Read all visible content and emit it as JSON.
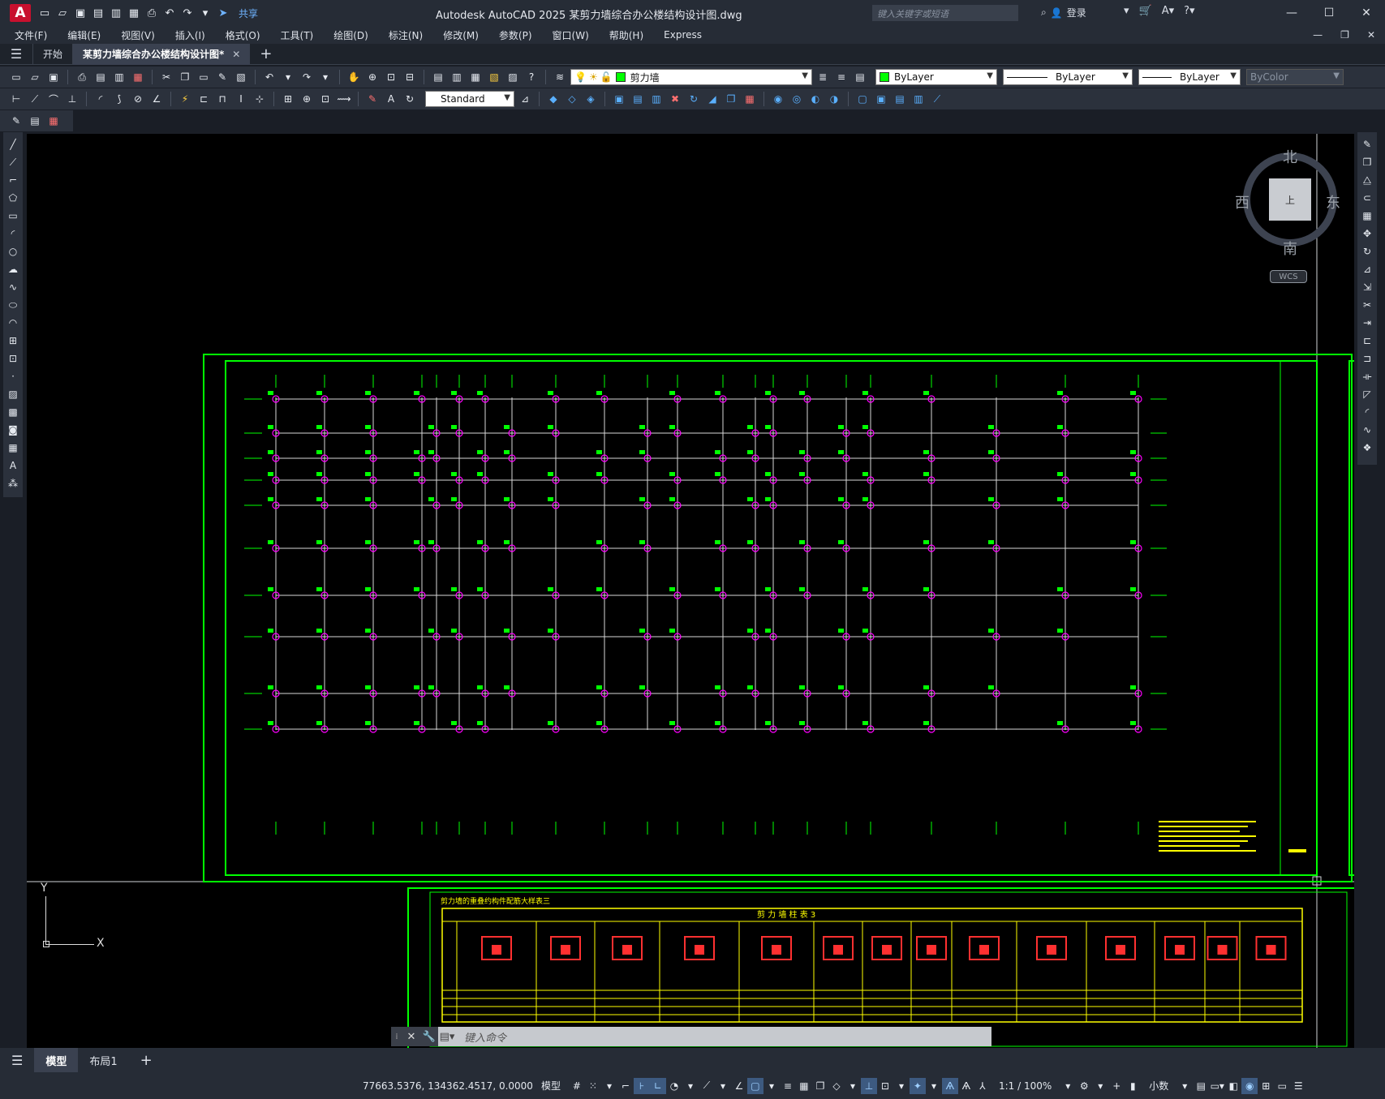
{
  "app": {
    "logo_letter": "A",
    "title": "Autodesk AutoCAD 2025    某剪力墙综合办公楼结构设计图.dwg",
    "share_label": "共享",
    "search_placeholder": "键入关键字或短语",
    "login_label": "登录"
  },
  "menu": [
    "文件(F)",
    "编辑(E)",
    "视图(V)",
    "插入(I)",
    "格式(O)",
    "工具(T)",
    "绘图(D)",
    "标注(N)",
    "修改(M)",
    "参数(P)",
    "窗口(W)",
    "帮助(H)",
    "Express"
  ],
  "tabs": {
    "start": "开始",
    "drawing": "某剪力墙综合办公楼结构设计图*"
  },
  "toolbar": {
    "layer_name": "剪力墙",
    "color": "ByLayer",
    "linetype": "ByLayer",
    "lineweight": "ByLayer",
    "plotstyle": "ByColor",
    "dimstyle": "Standard"
  },
  "viewcube": {
    "north": "北",
    "south": "南",
    "east": "东",
    "west": "西",
    "face": "上",
    "wcs": "WCS"
  },
  "drawing": {
    "table_title": "剪力墙的重叠约构件配筋大样表三",
    "table_header": "剪 力 墙 柱 表 3"
  },
  "command": {
    "prompt": "键入命令"
  },
  "layout_tabs": {
    "model": "模型",
    "layout1": "布局1"
  },
  "status": {
    "coords": "77663.5376, 134362.4517, 0.0000",
    "space": "模型",
    "scale": "1:1 / 100%",
    "units": "小数"
  },
  "colors": {
    "grid_green": "#00ff00",
    "axis_line": "#d8d8d8",
    "marker_magenta": "#ff00ff",
    "note_yellow": "#ffff00"
  }
}
